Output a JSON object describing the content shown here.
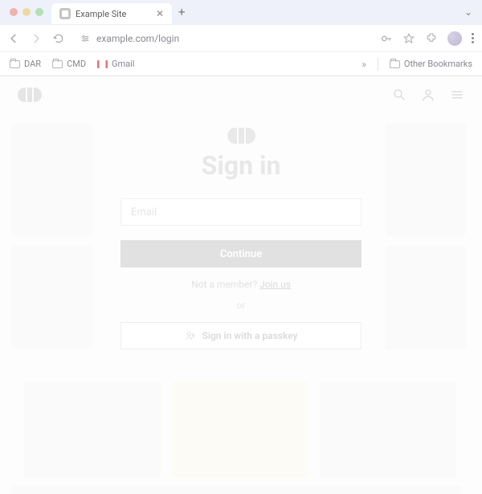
{
  "browser": {
    "tab_title": "Example Site",
    "address": "example.com/login",
    "bookmarks": [
      "DAR",
      "CMD",
      "Gmail"
    ],
    "other_bookmarks_label": "Other Bookmarks"
  },
  "page": {
    "heading": "Sign in",
    "email_placeholder": "Email",
    "continue_label": "Continue",
    "not_member_prefix": "Not a member? ",
    "join_label": "Join us",
    "or_label": "or",
    "passkey_label": "Sign in with a passkey"
  },
  "icons": {
    "search": "search-icon",
    "user": "user-icon",
    "menu": "hamburger-icon",
    "passkey": "passkey-icon"
  }
}
